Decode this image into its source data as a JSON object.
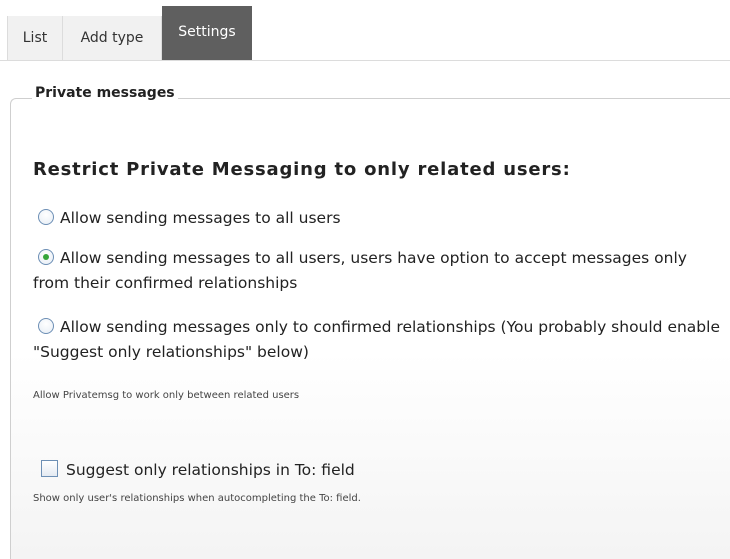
{
  "tabs": [
    {
      "label": "List"
    },
    {
      "label": "Add type"
    },
    {
      "label": "Settings"
    }
  ],
  "fieldset": {
    "legend": "Private messages"
  },
  "restrict": {
    "heading": "Restrict Private Messaging to only related users:",
    "options": [
      {
        "label": "Allow sending messages to all users",
        "checked": false
      },
      {
        "label": "Allow sending messages to all users, users have option to accept messages only from their confirmed relationships",
        "checked": true
      },
      {
        "label": "Allow sending messages only to confirmed relationships (You probably should enable \"Suggest only relationships\" below)",
        "checked": false
      }
    ],
    "description": "Allow Privatemsg to work only between related users"
  },
  "suggest": {
    "label": "Suggest only relationships in To: field",
    "checked": false,
    "description": "Show only user's relationships when autocompleting the To: field."
  },
  "colors": {
    "active_tab": "#5f5f5f",
    "radio_dot": "#35a53a",
    "control_border": "#6d8fb5"
  }
}
